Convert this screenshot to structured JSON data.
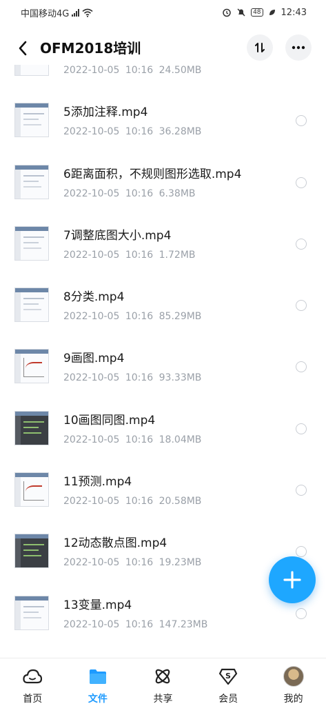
{
  "status_bar": {
    "carrier": "中国移动4G",
    "network_sup": "4G",
    "battery": "48",
    "time": "12:43"
  },
  "header": {
    "title": "OFM2018培训",
    "sort_icon": "sort-icon",
    "more_icon": "more-icon"
  },
  "files": [
    {
      "name": "",
      "date": "2022-10-05",
      "time": "10:16",
      "size": "24.50MB",
      "thumb": "light"
    },
    {
      "name": "5添加注释.mp4",
      "date": "2022-10-05",
      "time": "10:16",
      "size": "36.28MB",
      "thumb": "light"
    },
    {
      "name": "6距离面积，不规则图形选取.mp4",
      "date": "2022-10-05",
      "time": "10:16",
      "size": "6.38MB",
      "thumb": "light"
    },
    {
      "name": "7调整底图大小.mp4",
      "date": "2022-10-05",
      "time": "10:16",
      "size": "1.72MB",
      "thumb": "light"
    },
    {
      "name": "8分类.mp4",
      "date": "2022-10-05",
      "time": "10:16",
      "size": "85.29MB",
      "thumb": "light"
    },
    {
      "name": "9画图.mp4",
      "date": "2022-10-05",
      "time": "10:16",
      "size": "93.33MB",
      "thumb": "plot"
    },
    {
      "name": "10画图同图.mp4",
      "date": "2022-10-05",
      "time": "10:16",
      "size": "18.04MB",
      "thumb": "dark"
    },
    {
      "name": "11预测.mp4",
      "date": "2022-10-05",
      "time": "10:16",
      "size": "20.58MB",
      "thumb": "plot"
    },
    {
      "name": "12动态散点图.mp4",
      "date": "2022-10-05",
      "time": "10:16",
      "size": "19.23MB",
      "thumb": "dark"
    },
    {
      "name": "13变量.mp4",
      "date": "2022-10-05",
      "time": "10:16",
      "size": "147.23MB",
      "thumb": "light"
    }
  ],
  "nav": [
    {
      "label": "首页",
      "icon": "cloud-home-icon",
      "active": false
    },
    {
      "label": "文件",
      "icon": "folder-icon",
      "active": true
    },
    {
      "label": "共享",
      "icon": "share-icon",
      "active": false
    },
    {
      "label": "会员",
      "icon": "vip-icon",
      "active": false
    },
    {
      "label": "我的",
      "icon": "avatar",
      "active": false
    }
  ],
  "colors": {
    "accent": "#1e9bff",
    "fab": "#1ea7ff",
    "meta_text": "#9aa0a8"
  }
}
